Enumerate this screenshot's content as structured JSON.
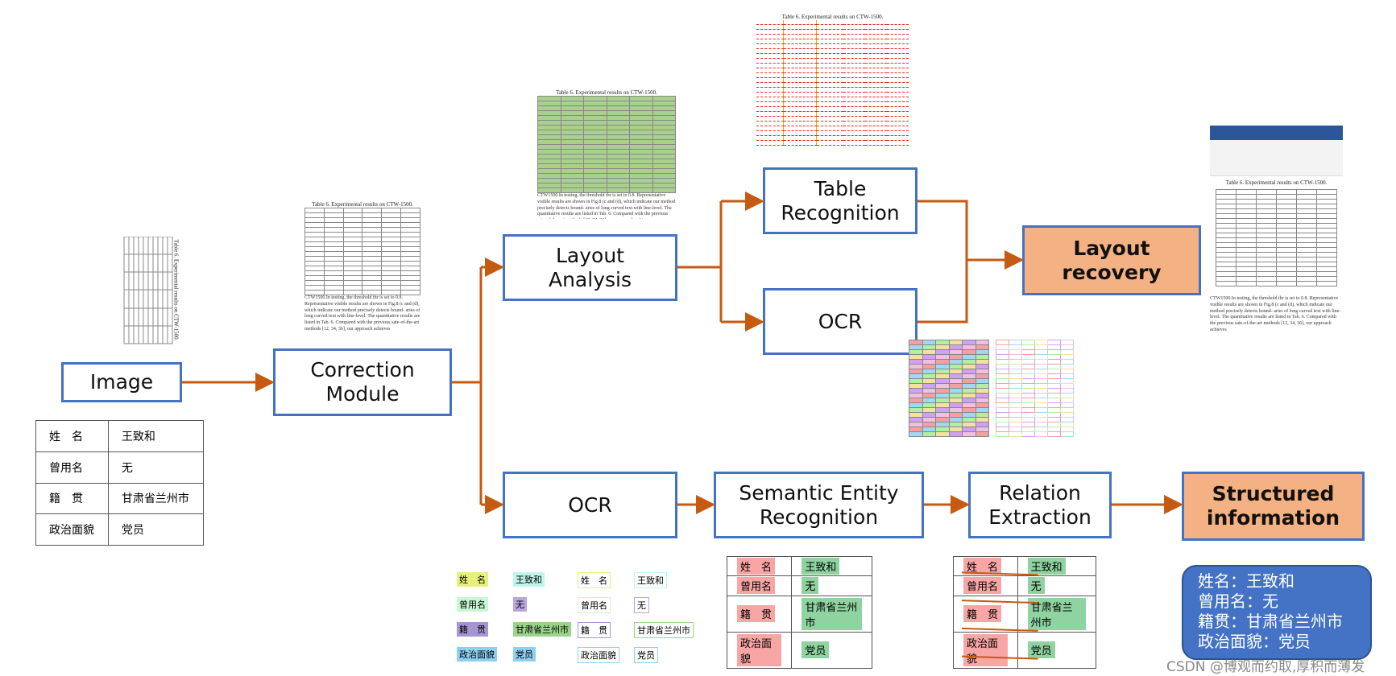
{
  "colors": {
    "box_border": "#4472c4",
    "output_fill": "#f4b183",
    "arrow": "#c55a11",
    "info_fill": "#4472c4",
    "key_highlight": "#f8a5a5",
    "value_highlight": "#8fd4a0"
  },
  "nodes": {
    "image": "Image",
    "correction": "Correction\nModule",
    "layout_analysis": "Layout\nAnalysis",
    "table_recognition": "Table\nRecognition",
    "ocr_top": "OCR",
    "layout_recovery": "Layout\nrecovery",
    "ocr_bottom": "OCR",
    "ser": "Semantic Entity\nRecognition",
    "re": "Relation\nExtraction",
    "structured": "Structured\ninformation"
  },
  "form": {
    "rows": [
      {
        "key": "姓　名",
        "value": "王致和"
      },
      {
        "key": "曾用名",
        "value": "无"
      },
      {
        "key": "籍　贯",
        "value": "甘肃省兰州市"
      },
      {
        "key": "政治面貌",
        "value": "党员"
      }
    ]
  },
  "table_caption": "Table 6. Experimental results on CTW-1500.",
  "doc_paragraph": "CTW1500.In testing, the threshold thr is set to 0.8. Representative visible results are shown in Fig.8 (c and (d), which indicate our method precisely detects bound- aries of long curved text with line-level. The quantitative results are listed in Tab. 6. Compared with the previous sate-of-the-art methods [12, 34, 36], our approach achieves",
  "info": {
    "lines": [
      "姓名：王致和",
      "曾用名：无",
      "籍贯：甘肃省兰州市",
      "政治面貌：党员"
    ]
  },
  "watermark": "CSDN @博观而约取,厚积而薄发"
}
